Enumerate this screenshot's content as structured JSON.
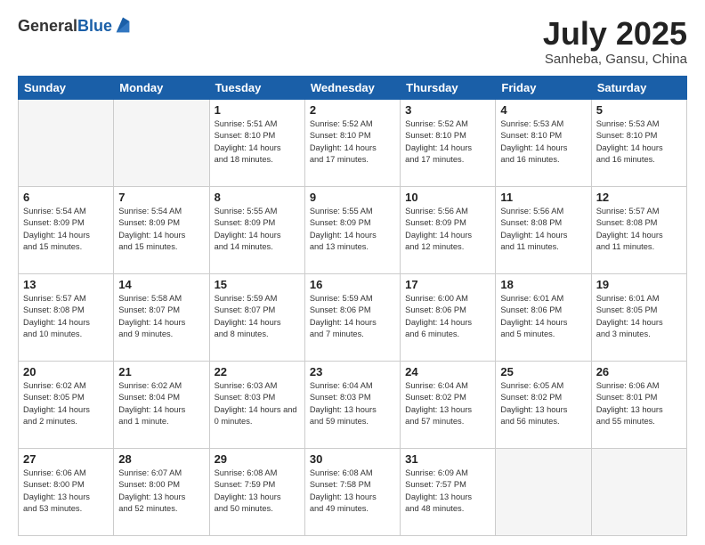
{
  "header": {
    "logo_general": "General",
    "logo_blue": "Blue",
    "title": "July 2025",
    "subtitle": "Sanheba, Gansu, China"
  },
  "days_of_week": [
    "Sunday",
    "Monday",
    "Tuesday",
    "Wednesday",
    "Thursday",
    "Friday",
    "Saturday"
  ],
  "weeks": [
    [
      {
        "day": "",
        "info": ""
      },
      {
        "day": "",
        "info": ""
      },
      {
        "day": "1",
        "info": "Sunrise: 5:51 AM\nSunset: 8:10 PM\nDaylight: 14 hours\nand 18 minutes."
      },
      {
        "day": "2",
        "info": "Sunrise: 5:52 AM\nSunset: 8:10 PM\nDaylight: 14 hours\nand 17 minutes."
      },
      {
        "day": "3",
        "info": "Sunrise: 5:52 AM\nSunset: 8:10 PM\nDaylight: 14 hours\nand 17 minutes."
      },
      {
        "day": "4",
        "info": "Sunrise: 5:53 AM\nSunset: 8:10 PM\nDaylight: 14 hours\nand 16 minutes."
      },
      {
        "day": "5",
        "info": "Sunrise: 5:53 AM\nSunset: 8:10 PM\nDaylight: 14 hours\nand 16 minutes."
      }
    ],
    [
      {
        "day": "6",
        "info": "Sunrise: 5:54 AM\nSunset: 8:09 PM\nDaylight: 14 hours\nand 15 minutes."
      },
      {
        "day": "7",
        "info": "Sunrise: 5:54 AM\nSunset: 8:09 PM\nDaylight: 14 hours\nand 15 minutes."
      },
      {
        "day": "8",
        "info": "Sunrise: 5:55 AM\nSunset: 8:09 PM\nDaylight: 14 hours\nand 14 minutes."
      },
      {
        "day": "9",
        "info": "Sunrise: 5:55 AM\nSunset: 8:09 PM\nDaylight: 14 hours\nand 13 minutes."
      },
      {
        "day": "10",
        "info": "Sunrise: 5:56 AM\nSunset: 8:09 PM\nDaylight: 14 hours\nand 12 minutes."
      },
      {
        "day": "11",
        "info": "Sunrise: 5:56 AM\nSunset: 8:08 PM\nDaylight: 14 hours\nand 11 minutes."
      },
      {
        "day": "12",
        "info": "Sunrise: 5:57 AM\nSunset: 8:08 PM\nDaylight: 14 hours\nand 11 minutes."
      }
    ],
    [
      {
        "day": "13",
        "info": "Sunrise: 5:57 AM\nSunset: 8:08 PM\nDaylight: 14 hours\nand 10 minutes."
      },
      {
        "day": "14",
        "info": "Sunrise: 5:58 AM\nSunset: 8:07 PM\nDaylight: 14 hours\nand 9 minutes."
      },
      {
        "day": "15",
        "info": "Sunrise: 5:59 AM\nSunset: 8:07 PM\nDaylight: 14 hours\nand 8 minutes."
      },
      {
        "day": "16",
        "info": "Sunrise: 5:59 AM\nSunset: 8:06 PM\nDaylight: 14 hours\nand 7 minutes."
      },
      {
        "day": "17",
        "info": "Sunrise: 6:00 AM\nSunset: 8:06 PM\nDaylight: 14 hours\nand 6 minutes."
      },
      {
        "day": "18",
        "info": "Sunrise: 6:01 AM\nSunset: 8:06 PM\nDaylight: 14 hours\nand 5 minutes."
      },
      {
        "day": "19",
        "info": "Sunrise: 6:01 AM\nSunset: 8:05 PM\nDaylight: 14 hours\nand 3 minutes."
      }
    ],
    [
      {
        "day": "20",
        "info": "Sunrise: 6:02 AM\nSunset: 8:05 PM\nDaylight: 14 hours\nand 2 minutes."
      },
      {
        "day": "21",
        "info": "Sunrise: 6:02 AM\nSunset: 8:04 PM\nDaylight: 14 hours\nand 1 minute."
      },
      {
        "day": "22",
        "info": "Sunrise: 6:03 AM\nSunset: 8:03 PM\nDaylight: 14 hours and 0 minutes."
      },
      {
        "day": "23",
        "info": "Sunrise: 6:04 AM\nSunset: 8:03 PM\nDaylight: 13 hours\nand 59 minutes."
      },
      {
        "day": "24",
        "info": "Sunrise: 6:04 AM\nSunset: 8:02 PM\nDaylight: 13 hours\nand 57 minutes."
      },
      {
        "day": "25",
        "info": "Sunrise: 6:05 AM\nSunset: 8:02 PM\nDaylight: 13 hours\nand 56 minutes."
      },
      {
        "day": "26",
        "info": "Sunrise: 6:06 AM\nSunset: 8:01 PM\nDaylight: 13 hours\nand 55 minutes."
      }
    ],
    [
      {
        "day": "27",
        "info": "Sunrise: 6:06 AM\nSunset: 8:00 PM\nDaylight: 13 hours\nand 53 minutes."
      },
      {
        "day": "28",
        "info": "Sunrise: 6:07 AM\nSunset: 8:00 PM\nDaylight: 13 hours\nand 52 minutes."
      },
      {
        "day": "29",
        "info": "Sunrise: 6:08 AM\nSunset: 7:59 PM\nDaylight: 13 hours\nand 50 minutes."
      },
      {
        "day": "30",
        "info": "Sunrise: 6:08 AM\nSunset: 7:58 PM\nDaylight: 13 hours\nand 49 minutes."
      },
      {
        "day": "31",
        "info": "Sunrise: 6:09 AM\nSunset: 7:57 PM\nDaylight: 13 hours\nand 48 minutes."
      },
      {
        "day": "",
        "info": ""
      },
      {
        "day": "",
        "info": ""
      }
    ]
  ]
}
